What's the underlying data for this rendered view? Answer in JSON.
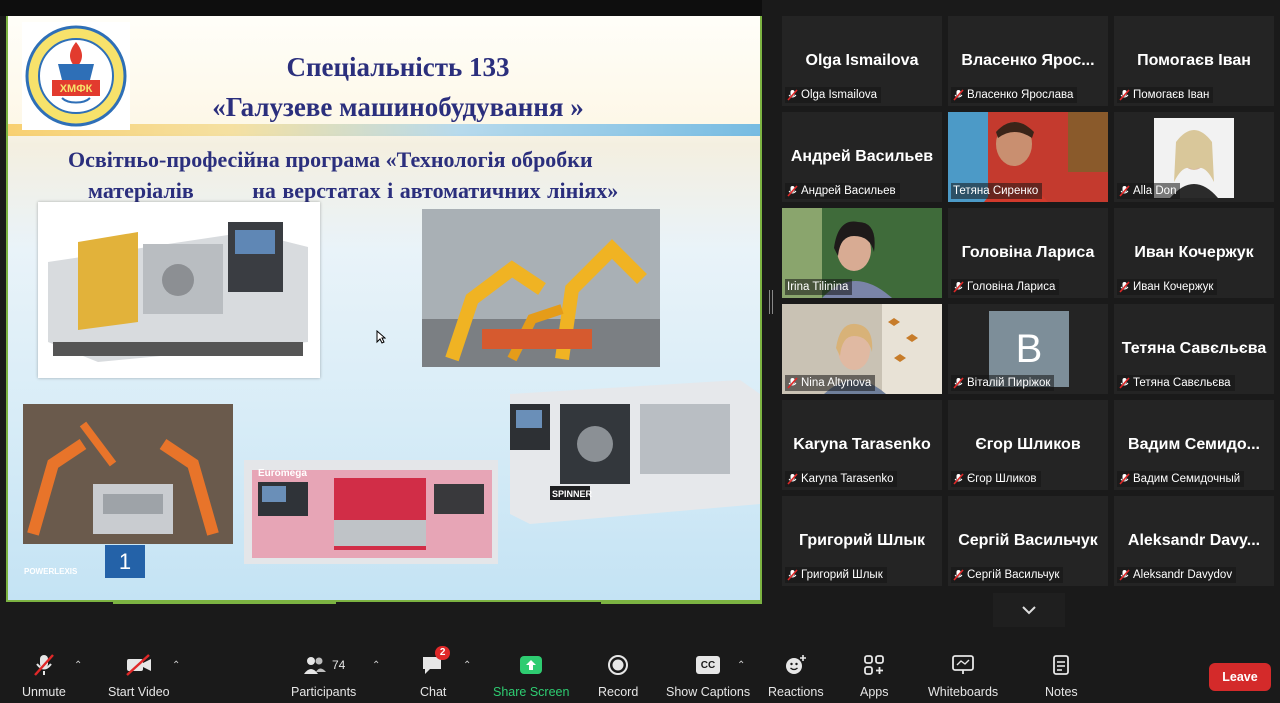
{
  "slide": {
    "logo_text": "ХМФК",
    "title_line1": "Спеціальність 133",
    "title_line2": "«Галузеве машинобудування »",
    "subtitle_line1": "Освітньо-професійна програма «Технологія обробки",
    "subtitle_line2": "матеріалів         на верстатах і автоматичних лініях»",
    "page_number": "1",
    "brand": "POWERLEXIS",
    "pink_lathe_brand": "Euromega",
    "spinner_brand": "SPINNER"
  },
  "participants": [
    {
      "big_name": "Olga Ismailova",
      "label": "Olga Ismailova",
      "video": false
    },
    {
      "big_name": "Власенко  Ярос...",
      "label": "Власенко Ярослава",
      "video": false
    },
    {
      "big_name": "Помогаєв Іван",
      "label": "Помогаєв Іван",
      "video": false
    },
    {
      "big_name": "Андрей Васильев",
      "label": "Андрей Васильев",
      "video": false
    },
    {
      "big_name": "",
      "label": "Тетяна Сиренко",
      "video": true,
      "active": true
    },
    {
      "big_name": "",
      "label": "Alla Don",
      "video": true
    },
    {
      "big_name": "",
      "label": "Irina Tilinina",
      "video": true
    },
    {
      "big_name": "Головіна Лариса",
      "label": "Головіна Лариса",
      "video": false
    },
    {
      "big_name": "Иван Кочержук",
      "label": "Иван Кочержук",
      "video": false
    },
    {
      "big_name": "",
      "label": "Nina Altynova",
      "video": true
    },
    {
      "big_name": "",
      "label": "Віталій Пиріжок",
      "avatar_letter": "В",
      "video": false
    },
    {
      "big_name": "Тетяна Савєльєва",
      "label": "Тетяна Савєльєва",
      "video": false
    },
    {
      "big_name": "Karyna Tarasenko",
      "label": "Karyna Tarasenko",
      "video": false
    },
    {
      "big_name": "Єгор Шликов",
      "label": "Єгор Шликов",
      "video": false
    },
    {
      "big_name": "Вадим  Семидо...",
      "label": "Вадим Семидочный",
      "video": false
    },
    {
      "big_name": "Григорий Шлык",
      "label": "Григорий Шлык",
      "video": false
    },
    {
      "big_name": "Сергій Васильчук",
      "label": "Сергій Васильчук",
      "video": false
    },
    {
      "big_name": "Aleksandr  Davy...",
      "label": "Aleksandr Davydov",
      "video": false
    }
  ],
  "toolbar": {
    "unmute": "Unmute",
    "start_video": "Start Video",
    "participants": "Participants",
    "participants_count": "74",
    "chat": "Chat",
    "chat_badge": "2",
    "share_screen": "Share Screen",
    "record": "Record",
    "show_captions": "Show Captions",
    "cc": "CC",
    "reactions": "Reactions",
    "apps": "Apps",
    "whiteboards": "Whiteboards",
    "notes": "Notes",
    "leave": "Leave"
  },
  "colors": {
    "share_green": "#2ecc71",
    "frame_green": "#7cb342",
    "leave_red": "#d42a2a",
    "active_speaker": "#d9e84a"
  }
}
